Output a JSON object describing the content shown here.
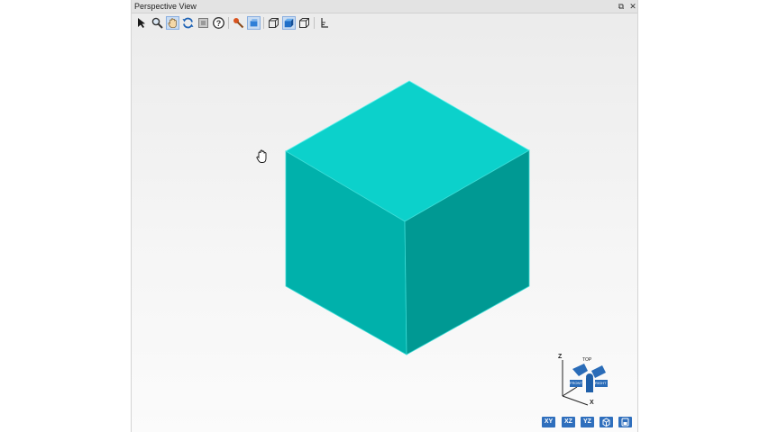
{
  "window": {
    "title": "Perspective View",
    "restore_icon": "restore-icon",
    "close_icon": "close-icon"
  },
  "toolbar": {
    "tools": [
      {
        "name": "select-arrow-icon"
      },
      {
        "name": "zoom-magnifier-icon"
      },
      {
        "name": "pan-hand-icon",
        "active": true
      },
      {
        "name": "rotate-icon"
      },
      {
        "name": "fit-view-icon"
      },
      {
        "name": "help-icon"
      },
      {
        "name": "pick-tool-icon"
      },
      {
        "name": "view-mode-icon",
        "active": true
      },
      {
        "name": "wireframe-cube-icon"
      },
      {
        "name": "shaded-cube-icon",
        "active": true
      },
      {
        "name": "outline-cube-icon"
      },
      {
        "name": "axis-icon"
      }
    ]
  },
  "triad": {
    "z_label": "Z",
    "x_label": "X",
    "top_label": "TOP",
    "front_label": "FRONT",
    "right_label": "RIGHT"
  },
  "view_buttons": {
    "xy": "XY",
    "xz": "XZ",
    "yz": "YZ",
    "iso_icon": "iso-cube-icon",
    "save_icon": "save-view-icon"
  },
  "colors": {
    "cube_top": "#0cd1cb",
    "cube_left": "#00b1ab",
    "cube_right": "#009993",
    "accent": "#2f6fbd"
  }
}
